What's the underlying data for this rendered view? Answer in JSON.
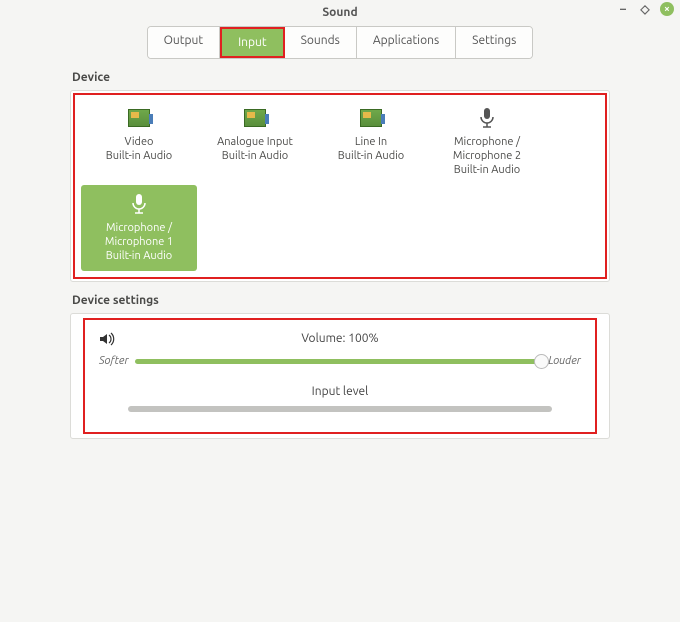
{
  "window": {
    "title": "Sound"
  },
  "tabs": [
    {
      "label": "Output",
      "active": false
    },
    {
      "label": "Input",
      "active": true
    },
    {
      "label": "Sounds",
      "active": false
    },
    {
      "label": "Applications",
      "active": false
    },
    {
      "label": "Settings",
      "active": false
    }
  ],
  "sections": {
    "device_label": "Device",
    "device_settings_label": "Device settings"
  },
  "devices": [
    {
      "line1": "Video",
      "line2": "Built-in Audio",
      "line3": "",
      "icon": "card",
      "selected": false
    },
    {
      "line1": "Analogue Input",
      "line2": "Built-in Audio",
      "line3": "",
      "icon": "card",
      "selected": false
    },
    {
      "line1": "Line In",
      "line2": "Built-in Audio",
      "line3": "",
      "icon": "card",
      "selected": false
    },
    {
      "line1": "Microphone /",
      "line2": "Microphone 2",
      "line3": "Built-in Audio",
      "icon": "mic",
      "selected": false
    },
    {
      "line1": "Microphone /",
      "line2": "Microphone 1",
      "line3": "Built-in Audio",
      "icon": "mic",
      "selected": true
    }
  ],
  "settings": {
    "volume_label": "Volume: 100%",
    "softer_label": "Softer",
    "louder_label": "Louder",
    "input_level_label": "Input level",
    "volume_percent": 100
  }
}
